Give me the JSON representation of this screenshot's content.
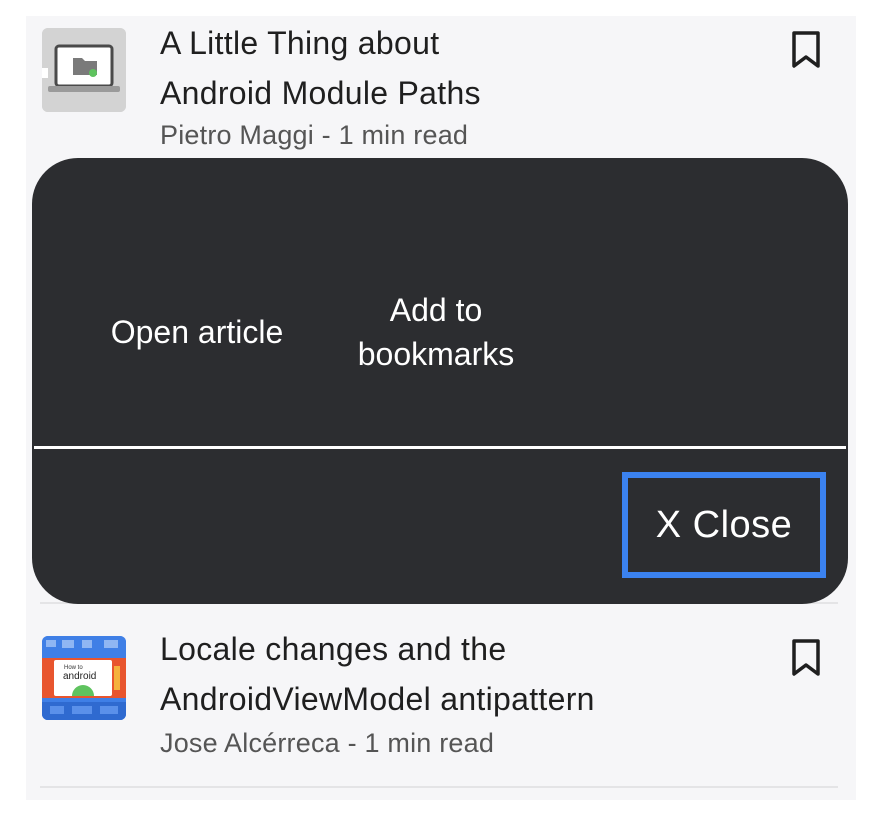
{
  "articles": [
    {
      "title_line1": "A Little Thing about",
      "title_line2": "Android Module Paths",
      "meta": "Pietro Maggi - 1 min read",
      "thumbnail_icon": "laptop-folder-icon",
      "bookmark_icon": "bookmark-icon"
    },
    {
      "title_line1": "Locale changes and the",
      "title_line2": "AndroidViewModel antipattern",
      "meta": "Jose Alcérreca - 1 min read",
      "thumbnail_icon": "android-illustration-icon",
      "thumbnail_text_small": "How to",
      "thumbnail_text": "android",
      "bookmark_icon": "bookmark-icon"
    }
  ],
  "sheet": {
    "open_article": "Open article",
    "add_bookmarks": "Add to bookmarks",
    "close": "X Close"
  },
  "colors": {
    "sheet_bg": "#2c2d30",
    "focus_outline": "#3b82f0",
    "feed_bg": "#f6f6f8"
  }
}
